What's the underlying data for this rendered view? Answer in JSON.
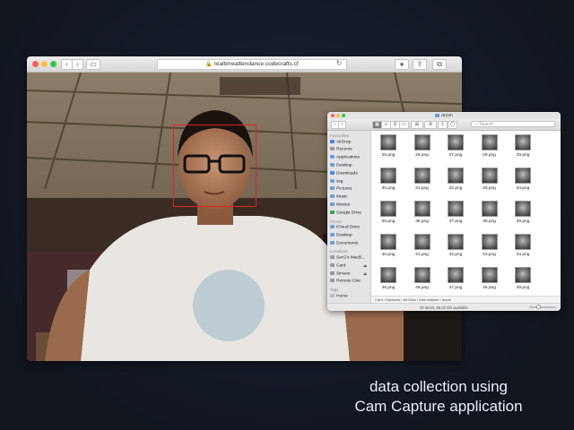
{
  "safari": {
    "url": "realtimeattendance.codecrafts.cf",
    "back_icon": "chevron-left-icon",
    "forward_icon": "chevron-right-icon",
    "sidebar_icon": "sidebar-icon",
    "lock_icon": "lock-icon",
    "reload_icon": "reload-icon",
    "toolbar_icons": [
      "info-icon",
      "share-icon",
      "tabs-icon"
    ],
    "traffic_lights": [
      "#fc605b",
      "#fdbc40",
      "#34c84a"
    ]
  },
  "camera": {
    "face_box_color": "#e0261a"
  },
  "finder": {
    "title": "aryan",
    "search_placeholder": "Search",
    "sidebar": {
      "sections": [
        {
          "heading": "Favourites",
          "items": [
            {
              "label": "AirDrop",
              "icon": "airdrop-icon",
              "color": "#3a8ee6"
            },
            {
              "label": "Recents",
              "icon": "clock-icon",
              "color": "#9a9a9a"
            },
            {
              "label": "Applications",
              "icon": "applications-icon",
              "color": "#6a9be0"
            },
            {
              "label": "Desktop",
              "icon": "desktop-icon",
              "color": "#6aa0de"
            },
            {
              "label": "Downloads",
              "icon": "downloads-icon",
              "color": "#3a8ee6"
            },
            {
              "label": "ssg",
              "icon": "home-icon",
              "color": "#6aa0de"
            },
            {
              "label": "Pictures",
              "icon": "pictures-icon",
              "color": "#6aa0de"
            },
            {
              "label": "Music",
              "icon": "music-icon",
              "color": "#6aa0de"
            },
            {
              "label": "Movies",
              "icon": "movies-icon",
              "color": "#6aa0de"
            },
            {
              "label": "Google Drive",
              "icon": "google-drive-icon",
              "color": "#34a853"
            }
          ]
        },
        {
          "heading": "iCloud",
          "items": [
            {
              "label": "iCloud Drive",
              "icon": "cloud-icon",
              "color": "#6aa0de"
            },
            {
              "label": "Desktop",
              "icon": "desktop-icon",
              "color": "#6aa0de"
            },
            {
              "label": "Documents",
              "icon": "documents-icon",
              "color": "#6aa0de"
            }
          ]
        },
        {
          "heading": "Locations",
          "items": [
            {
              "label": "SerG's MacB...",
              "icon": "laptop-icon",
              "color": "#9a9a9a"
            },
            {
              "label": "Card",
              "icon": "drive-icon",
              "color": "#9a9a9a",
              "badge": "⏏"
            },
            {
              "label": "Sirreen",
              "icon": "drive-icon",
              "color": "#9a9a9a",
              "badge": "⏏"
            },
            {
              "label": "Remote Disc",
              "icon": "disc-icon",
              "color": "#9a9a9a"
            }
          ]
        },
        {
          "heading": "Tags",
          "items": [
            {
              "label": "Home",
              "icon": "tag-icon",
              "color": "#bdbdbd"
            }
          ]
        }
      ]
    },
    "files": [
      "25.png",
      "26.png",
      "27.png",
      "28.png",
      "29.png",
      "30.png",
      "31.png",
      "32.png",
      "33.png",
      "34.png",
      "35.png",
      "36.png",
      "37.png",
      "38.png",
      "39.png",
      "40.png",
      "41.png",
      "42.png",
      "43.png",
      "44.png",
      "45.png",
      "46.png",
      "47.png",
      "48.png",
      "49.png"
    ],
    "path": "Card › Datasets › Att Data › train dataset › aryan",
    "status": "50 items, 96.03 GB available"
  },
  "caption": {
    "line1": "data collection using",
    "line2": "Cam Capture application"
  }
}
